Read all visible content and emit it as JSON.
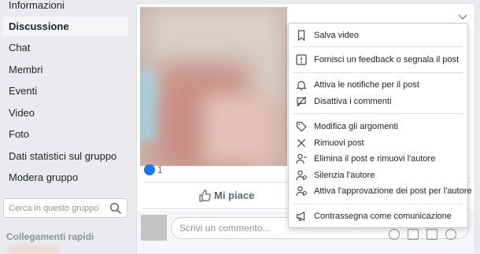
{
  "sidebar": {
    "items": [
      {
        "label": "Informazioni",
        "active": false
      },
      {
        "label": "Discussione",
        "active": true
      },
      {
        "label": "Chat",
        "active": false
      },
      {
        "label": "Membri",
        "active": false
      },
      {
        "label": "Eventi",
        "active": false
      },
      {
        "label": "Video",
        "active": false
      },
      {
        "label": "Foto",
        "active": false
      },
      {
        "label": "Dati statistici sul gruppo",
        "active": false
      },
      {
        "label": "Modera gruppo",
        "active": false
      }
    ],
    "search_placeholder": "Cerca in questo gruppo",
    "quick_links_title": "Collegamenti rapidi"
  },
  "post": {
    "reaction_count": "1",
    "like_label": "Mi piace",
    "comment_placeholder": "Scrivi un commento..."
  },
  "menu": {
    "items": [
      {
        "label": "Salva video",
        "icon": "bookmark-icon"
      },
      {
        "label": "Fornisci un feedback o segnala il post",
        "icon": "report-icon"
      },
      {
        "label": "Attiva le notifiche per il post",
        "icon": "bell-icon"
      },
      {
        "label": "Disattiva i commenti",
        "icon": "comment-off-icon"
      },
      {
        "label": "Modifica gli argomenti",
        "icon": "tag-icon"
      },
      {
        "label": "Rimuovi post",
        "icon": "close-icon"
      },
      {
        "label": "Elimina il post e rimuovi l'autore",
        "icon": "user-remove-icon"
      },
      {
        "label": "Silenzia l'autore",
        "icon": "user-mute-icon"
      },
      {
        "label": "Attiva l'approvazione dei post per l'autore",
        "icon": "user-approve-icon"
      },
      {
        "label": "Contrassegna come comunicazione",
        "icon": "megaphone-icon"
      }
    ]
  },
  "colors": {
    "like_blue": "#1877f2",
    "page_bg": "#e9ebee"
  }
}
